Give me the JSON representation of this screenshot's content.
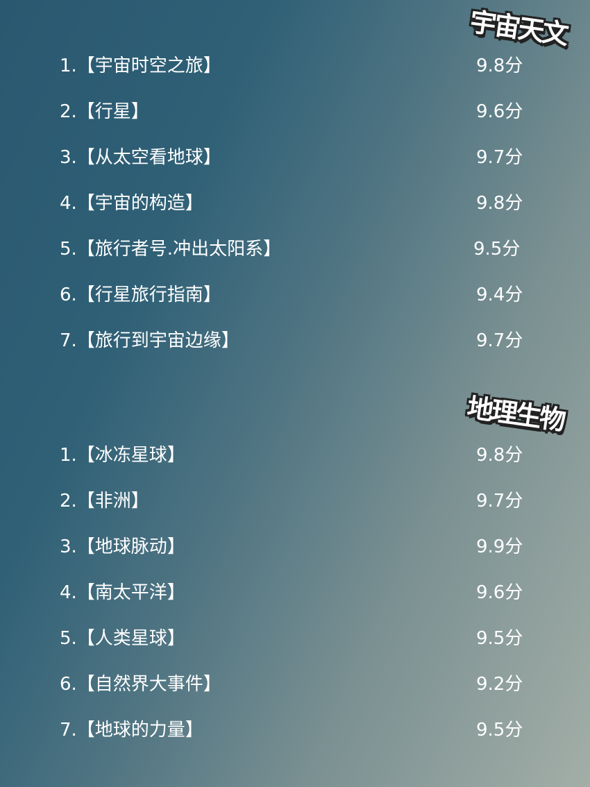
{
  "sections": [
    {
      "tag": "宇宙天文",
      "items": [
        {
          "title": "1.【宇宙时空之旅】",
          "score": "9.8分"
        },
        {
          "title": "2.【行星】",
          "score": "9.6分"
        },
        {
          "title": "3.【从太空看地球】",
          "score": "9.7分"
        },
        {
          "title": "4.【宇宙的构造】",
          "score": "9.8分"
        },
        {
          "title": "5.【旅行者号.冲出太阳系】",
          "score": "9.5分"
        },
        {
          "title": "6.【行星旅行指南】",
          "score": "9.4分"
        },
        {
          "title": "7.【旅行到宇宙边缘】",
          "score": "9.7分"
        }
      ]
    },
    {
      "tag": "地理生物",
      "items": [
        {
          "title": "1.【冰冻星球】",
          "score": "9.8分"
        },
        {
          "title": "2.【非洲】",
          "score": "9.7分"
        },
        {
          "title": "3.【地球脉动】",
          "score": "9.9分"
        },
        {
          "title": "4.【南太平洋】",
          "score": "9.6分"
        },
        {
          "title": "5.【人类星球】",
          "score": "9.5分"
        },
        {
          "title": "6.【自然界大事件】",
          "score": "9.2分"
        },
        {
          "title": "7.【地球的力量】",
          "score": "9.5分"
        }
      ]
    }
  ]
}
